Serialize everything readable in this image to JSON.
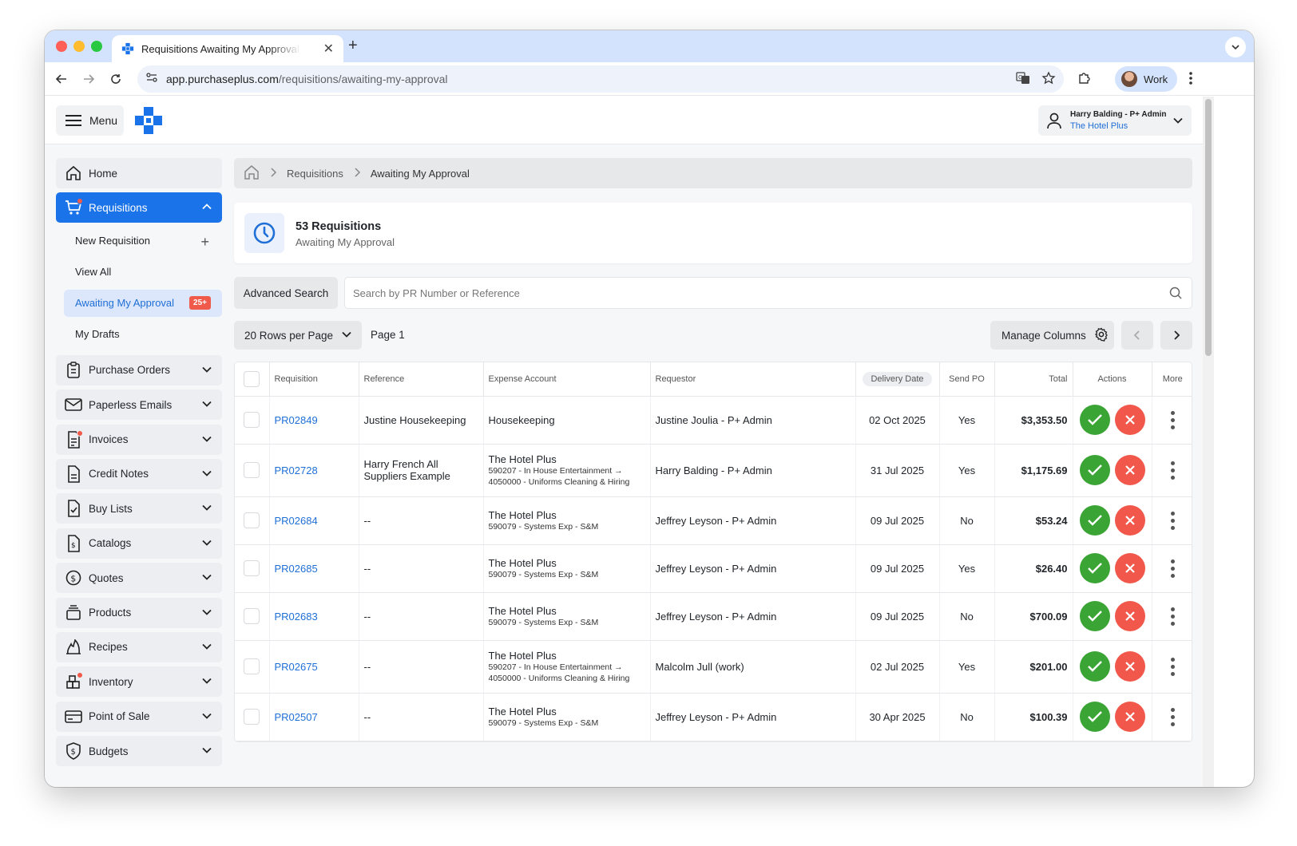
{
  "browser": {
    "tab_title": "Requisitions Awaiting My Approval",
    "url_host": "app.purchaseplus.com",
    "url_path": "/requisitions/awaiting-my-approval",
    "profile_label": "Work"
  },
  "topbar": {
    "menu_label": "Menu",
    "user_name": "Harry Balding - P+ Admin",
    "user_org": "The Hotel Plus"
  },
  "sidebar": {
    "home": "Home",
    "requisitions": "Requisitions",
    "sub": {
      "new_requisition": "New Requisition",
      "view_all": "View All",
      "awaiting": "Awaiting My Approval",
      "awaiting_badge": "25+",
      "my_drafts": "My Drafts"
    },
    "items": [
      {
        "label": "Purchase Orders",
        "icon": "clipboard-icon"
      },
      {
        "label": "Paperless Emails",
        "icon": "envelope-icon"
      },
      {
        "label": "Invoices",
        "icon": "invoice-icon"
      },
      {
        "label": "Credit Notes",
        "icon": "document-icon"
      },
      {
        "label": "Buy Lists",
        "icon": "checklist-icon"
      },
      {
        "label": "Catalogs",
        "icon": "catalog-dollar-icon"
      },
      {
        "label": "Quotes",
        "icon": "dollar-circle-icon"
      },
      {
        "label": "Products",
        "icon": "box-icon"
      },
      {
        "label": "Recipes",
        "icon": "flame-icon"
      },
      {
        "label": "Inventory",
        "icon": "inventory-icon"
      },
      {
        "label": "Point of Sale",
        "icon": "card-icon"
      },
      {
        "label": "Budgets",
        "icon": "shield-dollar-icon"
      }
    ]
  },
  "breadcrumb": {
    "level1": "Requisitions",
    "level2": "Awaiting My Approval"
  },
  "header": {
    "title": "53 Requisitions",
    "subtitle": "Awaiting My Approval"
  },
  "search": {
    "advanced_label": "Advanced Search",
    "placeholder": "Search by PR Number or Reference"
  },
  "controls": {
    "rows_per_page": "20 Rows per Page",
    "page_label": "Page 1",
    "manage_columns": "Manage Columns"
  },
  "table": {
    "headers": {
      "requisition": "Requisition",
      "reference": "Reference",
      "expense_account": "Expense Account",
      "requestor": "Requestor",
      "delivery_date": "Delivery Date",
      "send_po": "Send PO",
      "total": "Total",
      "actions": "Actions",
      "more": "More"
    },
    "rows": [
      {
        "req": "PR02849",
        "ref": "Justine Housekeeping",
        "acct_main": "Housekeeping",
        "acct_sub": "",
        "requestor": "Justine Joulia - P+ Admin",
        "date": "02 Oct 2025",
        "send_po": "Yes",
        "total": "$3,353.50"
      },
      {
        "req": "PR02728",
        "ref": "Harry French All Suppliers Example",
        "acct_main": "The Hotel Plus",
        "acct_sub": "590207 - In House Entertainment → 4050000 - Uniforms Cleaning & Hiring",
        "requestor": "Harry Balding - P+ Admin",
        "date": "31 Jul 2025",
        "send_po": "Yes",
        "total": "$1,175.69"
      },
      {
        "req": "PR02684",
        "ref": "--",
        "acct_main": "The Hotel Plus",
        "acct_sub": "590079 - Systems Exp - S&M",
        "requestor": "Jeffrey Leyson - P+ Admin",
        "date": "09 Jul 2025",
        "send_po": "No",
        "total": "$53.24"
      },
      {
        "req": "PR02685",
        "ref": "--",
        "acct_main": "The Hotel Plus",
        "acct_sub": "590079 - Systems Exp - S&M",
        "requestor": "Jeffrey Leyson - P+ Admin",
        "date": "09 Jul 2025",
        "send_po": "Yes",
        "total": "$26.40"
      },
      {
        "req": "PR02683",
        "ref": "--",
        "acct_main": "The Hotel Plus",
        "acct_sub": "590079 - Systems Exp - S&M",
        "requestor": "Jeffrey Leyson - P+ Admin",
        "date": "09 Jul 2025",
        "send_po": "No",
        "total": "$700.09"
      },
      {
        "req": "PR02675",
        "ref": "--",
        "acct_main": "The Hotel Plus",
        "acct_sub": "590207 - In House Entertainment → 4050000 - Uniforms Cleaning & Hiring",
        "requestor": "Malcolm Jull (work)",
        "date": "02 Jul 2025",
        "send_po": "Yes",
        "total": "$201.00"
      },
      {
        "req": "PR02507",
        "ref": "--",
        "acct_main": "The Hotel Plus",
        "acct_sub": "590079 - Systems Exp - S&M",
        "requestor": "Jeffrey Leyson - P+ Admin",
        "date": "30 Apr 2025",
        "send_po": "No",
        "total": "$100.39"
      }
    ]
  },
  "colors": {
    "primary": "#1a73e8",
    "approve": "#3aa435",
    "reject": "#f1574b",
    "badge": "#f05a4a"
  }
}
